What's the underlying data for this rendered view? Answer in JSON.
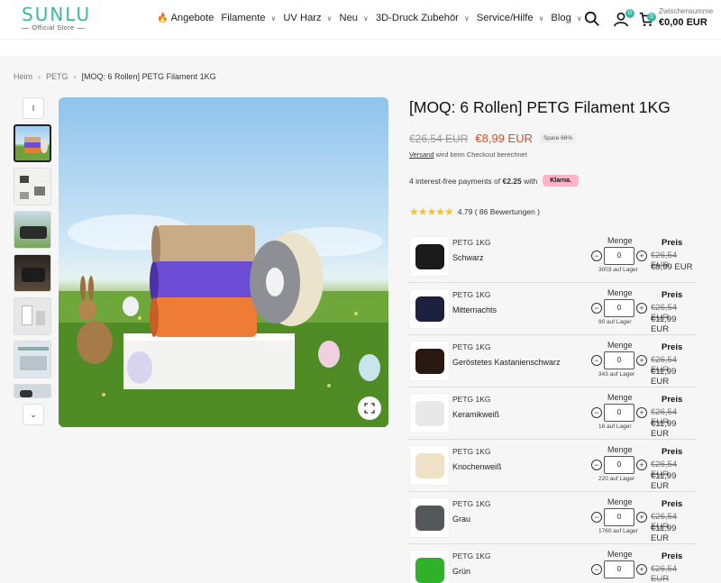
{
  "header": {
    "logo": "SUNLU",
    "logo_sub": "Official Store",
    "nav": [
      {
        "label": "Angebote",
        "flame": true,
        "chevron": false
      },
      {
        "label": "Filamente",
        "chevron": true
      },
      {
        "label": "UV Harz",
        "chevron": true
      },
      {
        "label": "Neu",
        "chevron": true
      },
      {
        "label": "3D-Druck Zubehör",
        "chevron": true
      },
      {
        "label": "Service/Hilfe",
        "chevron": true
      },
      {
        "label": "Blog",
        "chevron": true
      }
    ],
    "user_badge": "0",
    "cart_badge": "0",
    "subtotal_label": "Zwischensumme",
    "subtotal_value": "€0,00 EUR"
  },
  "breadcrumb": [
    "Heim",
    "PETG",
    "[MOQ: 6 Rollen] PETG Filament 1KG"
  ],
  "product": {
    "title": "[MOQ: 6 Rollen] PETG Filament 1KG",
    "old_price": "€26,54 EUR",
    "new_price": "€8,99 EUR",
    "save_badge": "Spare 66%",
    "shipping_link": "Versand",
    "shipping_text": " wird beim Checkout berechnet",
    "klarna_text": "4 interest-free payments of ",
    "klarna_amount": "€2.25",
    "klarna_with": " with",
    "klarna_logo": "Klarna.",
    "rating_text": "4.79 ( 86  Bewertungen )",
    "rating_stars": "★★★★★"
  },
  "variants": [
    {
      "name": "PETG 1KG",
      "color": "Schwarz",
      "swatch": "#1a1a1a",
      "qty_label": "Menge",
      "qty": "0",
      "stock": "3003 auf Lager",
      "price_label": "Preis",
      "old": "€26,54 EUR",
      "new": "€8,99 EUR"
    },
    {
      "name": "PETG 1KG",
      "color": "Mitternachts",
      "swatch": "#1c2140",
      "qty_label": "Menge",
      "qty": "0",
      "stock": "90 auf Lager",
      "price_label": "Preis",
      "old": "€26,54 EUR",
      "new": "€11,99 EUR"
    },
    {
      "name": "PETG 1KG",
      "color": "Geröstetes Kastanienschwarz",
      "swatch": "#2a1812",
      "qty_label": "Menge",
      "qty": "0",
      "stock": "343 auf Lager",
      "price_label": "Preis",
      "old": "€26,54 EUR",
      "new": "€11,99 EUR"
    },
    {
      "name": "PETG 1KG",
      "color": "Keramikweiß",
      "swatch": "#e8e8e8",
      "qty_label": "Menge",
      "qty": "0",
      "stock": "16 auf Lager",
      "price_label": "Preis",
      "old": "€26,54 EUR",
      "new": "€11,99 EUR"
    },
    {
      "name": "PETG 1KG",
      "color": "Knochenweiß",
      "swatch": "#efe2c6",
      "qty_label": "Menge",
      "qty": "0",
      "stock": "220 auf Lager",
      "price_label": "Preis",
      "old": "€26,54 EUR",
      "new": "€11,99 EUR"
    },
    {
      "name": "PETG 1KG",
      "color": "Grau",
      "swatch": "#555858",
      "qty_label": "Menge",
      "qty": "0",
      "stock": "1760 auf Lager",
      "price_label": "Preis",
      "old": "€26,54 EUR",
      "new": "€11,99 EUR"
    },
    {
      "name": "PETG 1KG",
      "color": "Grün",
      "swatch": "#2fb12a",
      "qty_label": "Menge",
      "qty": "0",
      "stock": "",
      "price_label": "Preis",
      "old": "€26,54 EUR",
      "new": ""
    }
  ],
  "colors": {
    "brand": "#3db7a4",
    "sale": "#e04a1f",
    "klarna": "#ffb3c7"
  },
  "icons": [
    "search-icon",
    "user-icon",
    "cart-icon",
    "chevron-up-icon",
    "chevron-down-icon",
    "expand-icon",
    "flame-icon"
  ]
}
